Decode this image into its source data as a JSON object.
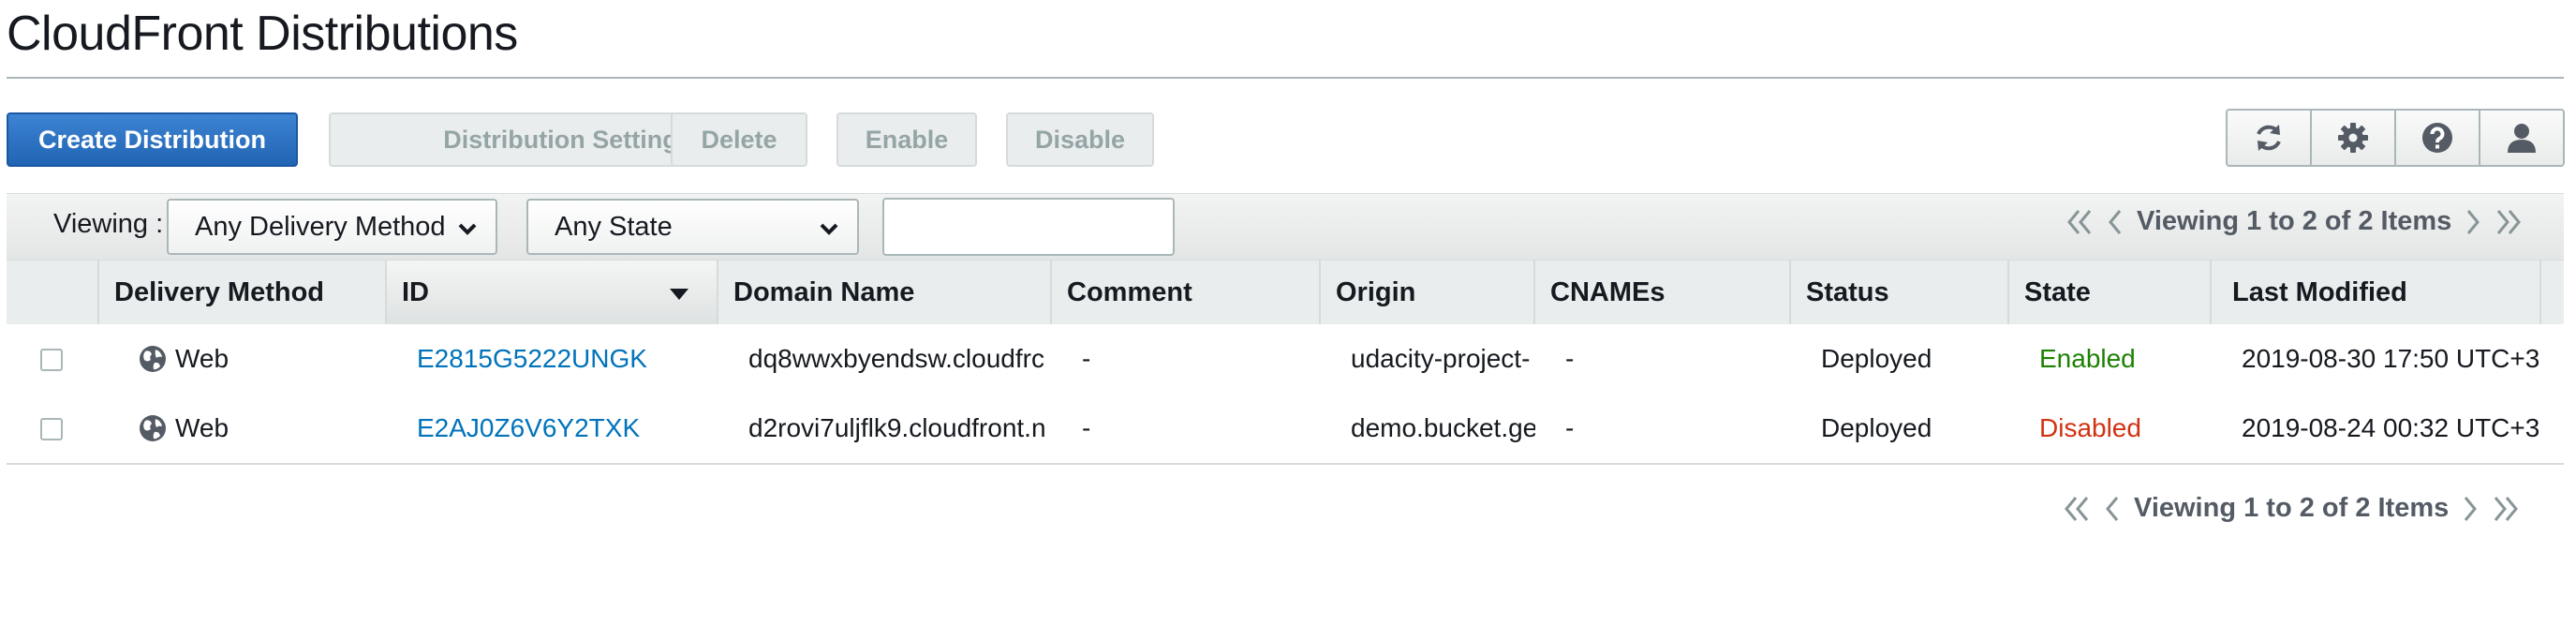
{
  "page": {
    "title": "CloudFront Distributions"
  },
  "toolbar": {
    "create_label": "Create Distribution",
    "settings_label": "Distribution Settings",
    "delete_label": "Delete",
    "enable_label": "Enable",
    "disable_label": "Disable",
    "icons": [
      "refresh-icon",
      "gear-icon",
      "help-icon",
      "user-icon"
    ]
  },
  "filter": {
    "viewing_label": "Viewing :",
    "delivery_method": "Any Delivery Method",
    "state": "Any State",
    "search_value": ""
  },
  "pagination": {
    "text": "Viewing 1 to 2 of 2 Items"
  },
  "table": {
    "columns": [
      "Delivery Method",
      "ID",
      "Domain Name",
      "Comment",
      "Origin",
      "CNAMEs",
      "Status",
      "State",
      "Last Modified"
    ],
    "rows": [
      {
        "delivery_method": "Web",
        "id": "E2815G5222UNGK",
        "domain_name": "dq8wwxbyendsw.cloudfrc",
        "comment": "-",
        "origin": "udacity-project-",
        "cnames": "-",
        "status": "Deployed",
        "state": "Enabled",
        "last_modified": "2019-08-30 17:50 UTC+3"
      },
      {
        "delivery_method": "Web",
        "id": "E2AJ0Z6V6Y2TXK",
        "domain_name": "d2rovi7uljflk9.cloudfront.n",
        "comment": "-",
        "origin": "demo.bucket.ge",
        "cnames": "-",
        "status": "Deployed",
        "state": "Disabled",
        "last_modified": "2019-08-24 00:32 UTC+3"
      }
    ]
  },
  "colors": {
    "primary": "#2164b4",
    "link": "#0073bb",
    "enabled": "#1d8102",
    "disabled": "#d13212"
  }
}
